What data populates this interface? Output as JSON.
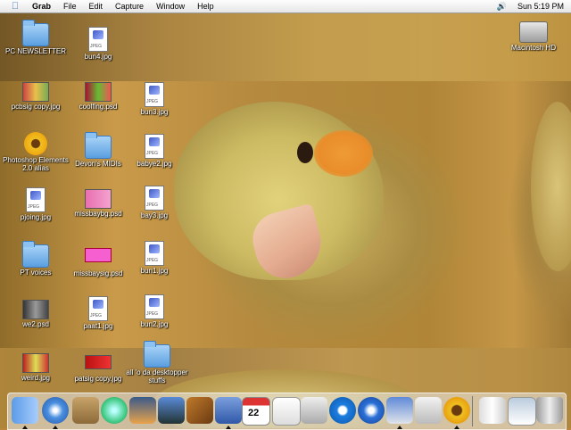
{
  "menubar": {
    "app_name": "Grab",
    "items": [
      "File",
      "Edit",
      "Capture",
      "Window",
      "Help"
    ],
    "clock": "Sun 5:19 PM"
  },
  "desktop_icons": {
    "pc_newsletter": "PC NEWSLETTER",
    "bun4": "bun4.jpg",
    "macintosh_hd": "Macintosh HD",
    "pcbsig": "pcbsig copy.jpg",
    "coolfing": "coolfing.psd",
    "bun3": "bun3.jpg",
    "photoshop_alias": "Photoshop Elements 2.0 alias",
    "devons_midis": "Devon's MIDIs",
    "babye2": "babye2.jpg",
    "pjoing": "pjoing.jpg",
    "missbaybg": "missbaybg.psd",
    "bay3": "bay3.jpg",
    "pt_voices": "PT voices",
    "missbaysig": "missbaysig.psd",
    "bun1": "bun1.jpg",
    "we2": "we2.psd",
    "paat1": "paat1.jpg",
    "bun2": "bun2.jpg",
    "weird": "weird.jpg",
    "patsig": "patsig copy.jpg",
    "desktopper": "all 'o da desktopper stuffs"
  },
  "dock_icons": [
    "finder-icon",
    "safari-icon",
    "address-book-icon",
    "itunes-icon",
    "iphoto-icon",
    "imovie-icon",
    "garageband-icon",
    "grab-icon",
    "ical-icon",
    "textedit-icon",
    "apple-icon",
    "quicktime-icon",
    "internet-explorer-icon",
    "preview-icon",
    "terminal-icon",
    "photoshop-elements-icon",
    "pictures-icon",
    "window-icon",
    "trash-icon"
  ],
  "colors": {
    "accent": "#3b6fb8",
    "cheek": "#ee9b34"
  }
}
